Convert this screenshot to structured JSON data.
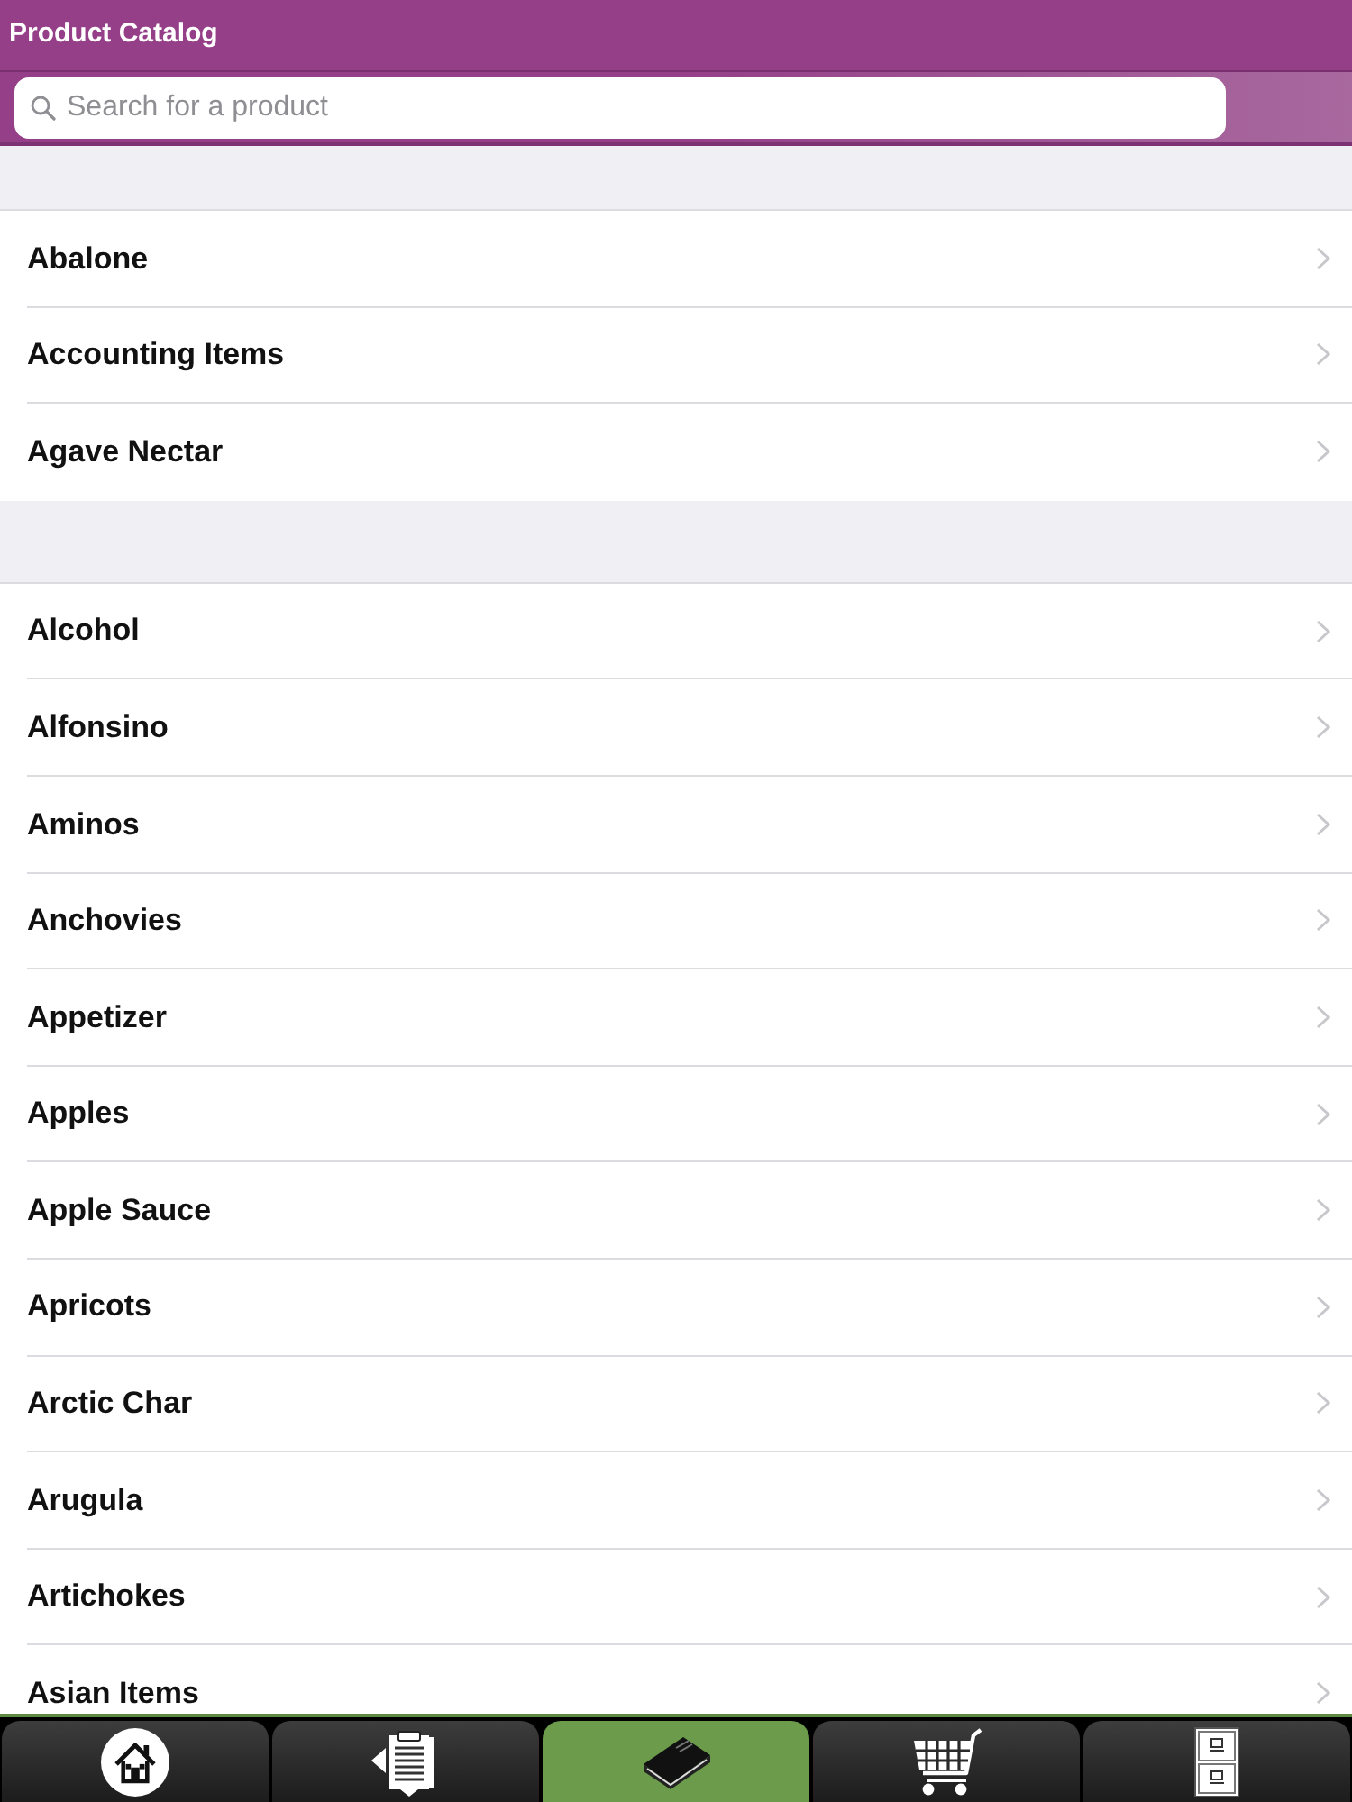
{
  "header": {
    "title": "Product Catalog"
  },
  "search": {
    "placeholder": "Search for a product"
  },
  "sections": [
    {
      "items": [
        {
          "label": "Abalone"
        },
        {
          "label": "Accounting Items"
        },
        {
          "label": "Agave Nectar"
        }
      ]
    },
    {
      "items": [
        {
          "label": "Alcohol"
        },
        {
          "label": "Alfonsino"
        },
        {
          "label": "Aminos"
        },
        {
          "label": "Anchovies"
        },
        {
          "label": "Appetizer"
        },
        {
          "label": "Apples"
        },
        {
          "label": "Apple Sauce"
        },
        {
          "label": "Apricots"
        },
        {
          "label": "Arctic Char"
        },
        {
          "label": "Arugula"
        },
        {
          "label": "Artichokes"
        },
        {
          "label": "Asian Items"
        }
      ]
    }
  ],
  "tab_bar": {
    "tabs": [
      {
        "kind": "home",
        "selected": false
      },
      {
        "kind": "orders",
        "selected": false
      },
      {
        "kind": "catalog",
        "selected": true
      },
      {
        "kind": "cart",
        "selected": false
      },
      {
        "kind": "cabinet",
        "selected": false
      }
    ]
  }
}
